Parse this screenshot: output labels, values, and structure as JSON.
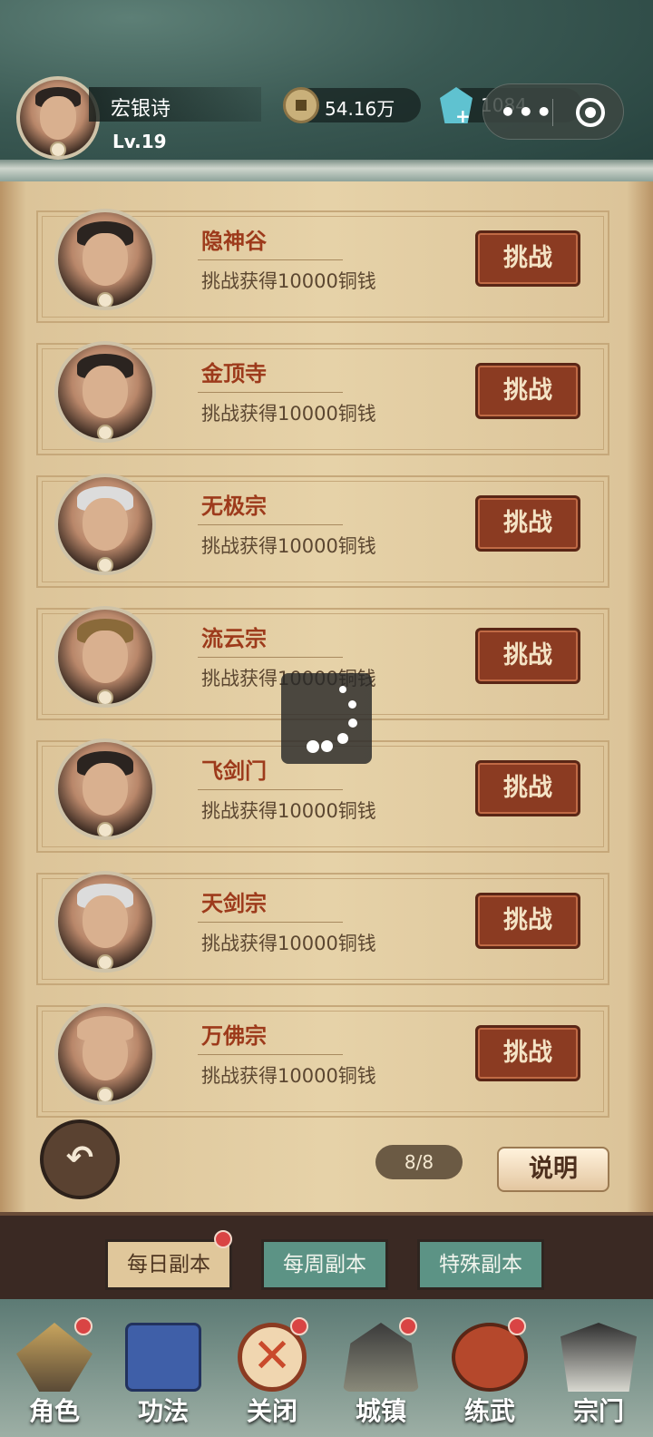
{
  "player": {
    "name": "宏银诗",
    "level": "Lv.19"
  },
  "currency": {
    "coins": "54.16万",
    "gems": "1084"
  },
  "capsule": {
    "more": "•••"
  },
  "dungeons": [
    {
      "title": "隐神谷",
      "desc": "挑战获得10000铜钱",
      "button": "挑战"
    },
    {
      "title": "金顶寺",
      "desc": "挑战获得10000铜钱",
      "button": "挑战"
    },
    {
      "title": "无极宗",
      "desc": "挑战获得10000铜钱",
      "button": "挑战"
    },
    {
      "title": "流云宗",
      "desc": "挑战获得10000铜钱",
      "button": "挑战"
    },
    {
      "title": "飞剑门",
      "desc": "挑战获得10000铜钱",
      "button": "挑战"
    },
    {
      "title": "天剑宗",
      "desc": "挑战获得10000铜钱",
      "button": "挑战"
    },
    {
      "title": "万佛宗",
      "desc": "挑战获得10000铜钱",
      "button": "挑战"
    }
  ],
  "pager": "8/8",
  "help": "说明",
  "back_icon": "↶",
  "tabs": [
    "每日副本",
    "每周副本",
    "特殊副本"
  ],
  "nav": [
    "角色",
    "功法",
    "关闭",
    "城镇",
    "练武",
    "宗门"
  ],
  "colors": {
    "accent": "#8b3b22",
    "title": "#9d3a1b",
    "badge": "#d94444"
  }
}
